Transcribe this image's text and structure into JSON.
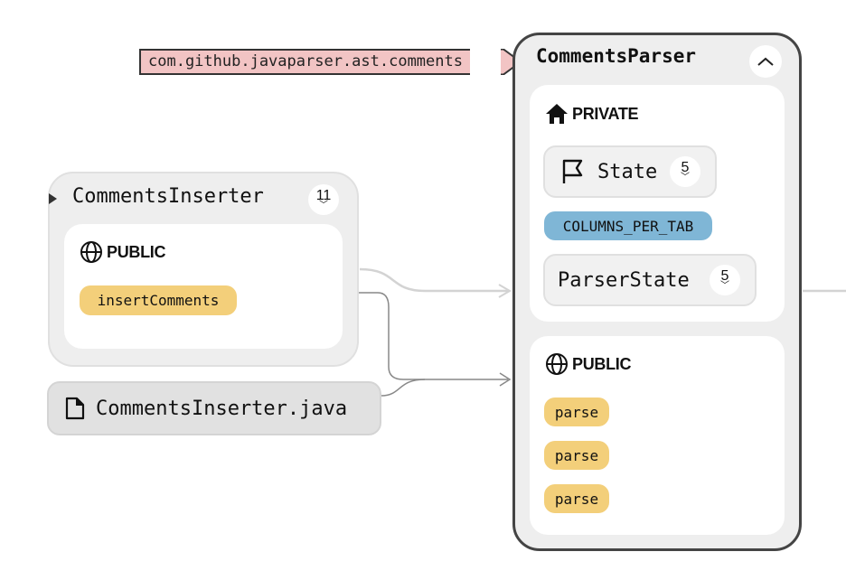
{
  "package": {
    "label": "com.github.javaparser.ast.comments"
  },
  "main_class": {
    "title": "CommentsParser",
    "collapse_icon": "chevron-up-icon",
    "private_section": {
      "label": "PRIVATE",
      "icon": "home-icon",
      "items": [
        {
          "kind": "class",
          "icon": "flag-icon",
          "label": "State",
          "count": "5"
        },
        {
          "kind": "constant",
          "label": "COLUMNS_PER_TAB"
        },
        {
          "kind": "class",
          "label": "ParserState",
          "count": "5"
        }
      ]
    },
    "public_section": {
      "label": "PUBLIC",
      "icon": "globe-icon",
      "methods": [
        "parse",
        "parse",
        "parse"
      ]
    }
  },
  "inserter_class": {
    "title": "CommentsInserter",
    "count": "11",
    "public_section": {
      "label": "PUBLIC",
      "icon": "globe-icon",
      "methods": [
        "insertComments"
      ]
    }
  },
  "file": {
    "icon": "file-icon",
    "label": "CommentsInserter.java"
  },
  "colors": {
    "package_tag": "#f2c4c4",
    "constant_pill": "#7fb6d6",
    "method_pill": "#f3cf7a",
    "node_bg": "#eeeeee",
    "border_dark": "#444444"
  }
}
